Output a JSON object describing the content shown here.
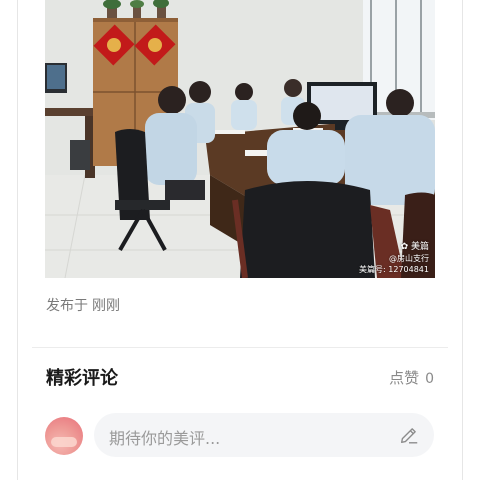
{
  "photo": {
    "watermark_brand": "美篇",
    "watermark_author": "@房山支行",
    "watermark_id": "美篇号: 12704841"
  },
  "post": {
    "published_label": "发布于",
    "published_time": "刚刚"
  },
  "comments": {
    "title": "精彩评论",
    "like_label": "点赞",
    "like_count": "0",
    "input_placeholder": "期待你的美评..."
  },
  "icons": {
    "edit": "pencil-icon",
    "brand": "meipian-logo-icon"
  }
}
